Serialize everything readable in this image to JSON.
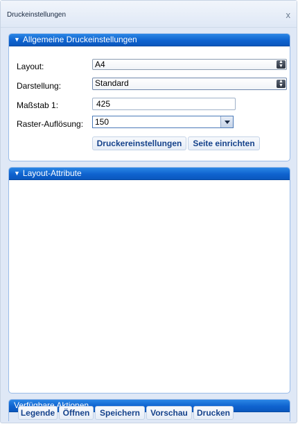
{
  "window": {
    "title": "Druckeinstellungen",
    "close_glyph": "x"
  },
  "general_panel": {
    "header": "Allgemeine Druckeinstellungen",
    "layout": {
      "label": "Layout:",
      "value": "A4"
    },
    "display": {
      "label": "Darstellung:",
      "value": "Standard"
    },
    "scale": {
      "label": "Maßstab 1:",
      "value": "425"
    },
    "raster": {
      "label": "Raster-Auflösung:",
      "value": "150"
    },
    "printer_settings_button": "Druckereinstellungen",
    "page_setup_button": "Seite einrichten"
  },
  "layout_attributes_panel": {
    "header": "Layout-Attribute"
  },
  "actions_panel": {
    "header": "Verfügbare Aktionen",
    "buttons": [
      "Legende",
      "Öffnen",
      "Speichern",
      "Vorschau",
      "Drucken"
    ]
  },
  "icons": {
    "collapse": "triangle-down-icon",
    "select_arrow": "up-down-arrows-icon",
    "combo_arrow": "chevron-down-icon",
    "close": "close-icon"
  },
  "colors": {
    "panel_header": "#0f63cf",
    "window_bg": "#dfe8f6",
    "button_text": "#15428b"
  }
}
